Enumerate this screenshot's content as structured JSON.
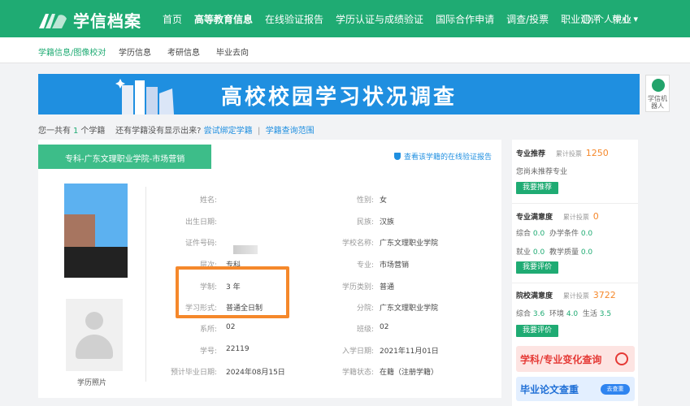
{
  "brand": {
    "name": "学信档案"
  },
  "nav": {
    "items": [
      "首页",
      "高等教育信息",
      "在线验证报告",
      "学历认证与成绩验证",
      "国际合作申请",
      "调查/投票",
      "职业测评",
      "就业"
    ],
    "user": "个人中心 ▾"
  },
  "subnav": {
    "items": [
      "学籍信息/图像校对",
      "学历信息",
      "考研信息",
      "毕业去向"
    ]
  },
  "banner": {
    "title": "高校校园学习状况调查"
  },
  "robot": {
    "label": "学信机器人"
  },
  "summary": {
    "prefix": "您一共有",
    "count": "1",
    "suffix": "个学籍",
    "question": "还有学籍没有显示出来?",
    "bind_link": "尝试绑定学籍",
    "sep": "|",
    "scope_link": "学籍查询范围"
  },
  "record": {
    "tag": "专科-广东文理职业学院-市场营销",
    "verify_link": "查看该学籍的在线验证报告",
    "photo_label": "学历照片",
    "left_fields": [
      {
        "label": "姓名:",
        "value": ""
      },
      {
        "label": "出生日期:",
        "value": ""
      },
      {
        "label": "证件号码:",
        "value": ""
      },
      {
        "label": "层次:",
        "value": "专科"
      },
      {
        "label": "学制:",
        "value": "3 年"
      },
      {
        "label": "学习形式:",
        "value": "普通全日制"
      },
      {
        "label": "系所:",
        "value": "02"
      },
      {
        "label": "学号:",
        "value": "22119"
      },
      {
        "label": "预计毕业日期:",
        "value": "2024年08月15日"
      }
    ],
    "right_fields": [
      {
        "label": "性别:",
        "value": "女"
      },
      {
        "label": "民族:",
        "value": "汉族"
      },
      {
        "label": "学校名称:",
        "value": "广东文理职业学院"
      },
      {
        "label": "专业:",
        "value": "市场营销"
      },
      {
        "label": "学历类别:",
        "value": "普通"
      },
      {
        "label": "分院:",
        "value": "广东文理职业学院"
      },
      {
        "label": "班级:",
        "value": "02"
      },
      {
        "label": "入学日期:",
        "value": "2021年11月01日"
      },
      {
        "label": "学籍状态:",
        "value": "在籍（注册学籍）"
      }
    ]
  },
  "sidebar": {
    "recommend": {
      "title": "专业推荐",
      "votes_label": "累计投票",
      "votes": "1250",
      "note": "您尚未推荐专业",
      "button": "我要推荐"
    },
    "satisfaction": {
      "title": "专业满意度",
      "votes_label": "累计投票",
      "votes": "0",
      "r1": [
        "综合",
        "0.0",
        "办学条件",
        "0.0"
      ],
      "r2": [
        "就业",
        "0.0",
        "教学质量",
        "0.0"
      ],
      "button": "我要评价"
    },
    "school": {
      "title": "院校满意度",
      "votes_label": "累计投票",
      "votes": "3722",
      "r1": [
        "综合",
        "3.6",
        "环境",
        "4.0",
        "生活",
        "3.5"
      ],
      "button": "我要评价"
    },
    "promo1": "学科/专业变化查询",
    "promo2": "毕业论文查重",
    "promo2_btn": "去查重"
  },
  "colors": {
    "brand_green": "#1fab73",
    "banner_blue": "#1f8fe0",
    "highlight_orange": "#f5882b"
  }
}
